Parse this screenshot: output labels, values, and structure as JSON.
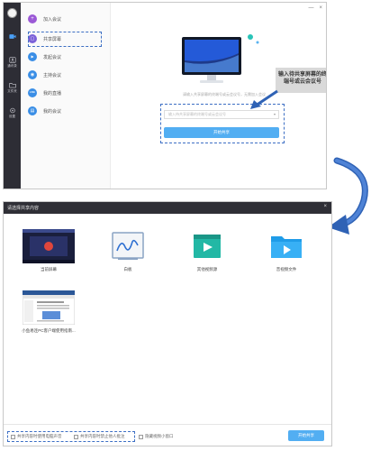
{
  "top_window": {
    "rail": {
      "items": [
        {
          "label": "",
          "icon": "video-icon"
        },
        {
          "label": "通讯录",
          "icon": "contacts-icon"
        },
        {
          "label": "文件夹",
          "icon": "folder-icon"
        },
        {
          "label": "设置",
          "icon": "gear-icon"
        }
      ]
    },
    "menu": {
      "items": [
        {
          "label": "加入会议",
          "icon": "plus-icon",
          "color": "#9b59d6",
          "glyph": "+"
        },
        {
          "label": "共享屏幕",
          "icon": "share-screen-icon",
          "color": "#7b61d8",
          "glyph": "▢"
        },
        {
          "label": "发起会议",
          "icon": "video-icon",
          "color": "#3a8ee6",
          "glyph": "▶"
        },
        {
          "label": "主持会议",
          "icon": "host-icon",
          "color": "#3a8ee6",
          "glyph": "◉"
        },
        {
          "label": "我的直播",
          "icon": "live-icon",
          "color": "#3a8ee6",
          "glyph": "LIVE"
        },
        {
          "label": "我的会议",
          "icon": "calendar-icon",
          "color": "#3a8ee6",
          "glyph": "▤"
        }
      ]
    },
    "window_controls": {
      "minimize": "—",
      "close": "×"
    },
    "tip": "请输入共享屏幕的终端号或云会议号，无需加入会议",
    "input_placeholder": "输入待共享屏幕的终端号或云会议号",
    "start_button": "开始共享",
    "callout": "输入待共享屏幕的终端号或云会议号"
  },
  "bottom_window": {
    "title": "请选择共享内容",
    "close": "×",
    "tiles": [
      {
        "caption": "当前屏幕",
        "icon": "desktop-screen-icon"
      },
      {
        "caption": "白板",
        "icon": "whiteboard-icon"
      },
      {
        "caption": "其他视频源",
        "icon": "video-source-icon"
      },
      {
        "caption": "音视频文件",
        "icon": "media-folder-icon"
      },
      {
        "caption": "小鱼易连PC客户端使用指南...",
        "icon": "document-window-icon"
      }
    ],
    "footer": {
      "checkbox_1": "共享内容时使用电脑声音",
      "checkbox_2": "共享内容时禁止他人批注",
      "checkbox_3": "隐藏视频小窗口",
      "start_button": "开始共享"
    }
  },
  "colors": {
    "accent": "#52aef2",
    "rail_bg": "#2d2d35",
    "highlight_dashed": "#3d6fc4",
    "arrow": "#2f62b5"
  }
}
